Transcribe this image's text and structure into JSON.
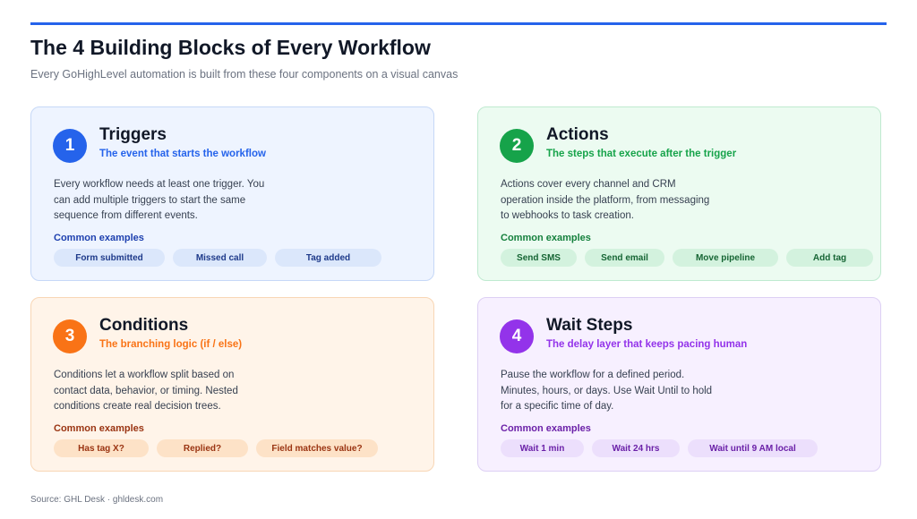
{
  "header": {
    "title": "The 4 Building Blocks of Every Workflow",
    "subtitle": "Every GoHighLevel automation is built from these four components on a visual canvas"
  },
  "colors": {
    "accent": "#2563eb",
    "triggers": "#2563eb",
    "actions": "#16a34a",
    "conditions": "#f97316",
    "wait_steps": "#9333ea"
  },
  "cards": [
    {
      "number": "1",
      "title": "Triggers",
      "subtitle": "The event that starts the workflow",
      "description": "Every workflow needs at least one trigger. You can add multiple triggers to start the same sequence from different events.",
      "examples_label": "Common examples",
      "examples": [
        "Form submitted",
        "Missed call",
        "Tag added"
      ]
    },
    {
      "number": "2",
      "title": "Actions",
      "subtitle": "The steps that execute after the trigger",
      "description": "Actions cover every channel and CRM operation inside the platform, from messaging to webhooks to task creation.",
      "examples_label": "Common examples",
      "examples": [
        "Send SMS",
        "Send email",
        "Move pipeline",
        "Add tag"
      ]
    },
    {
      "number": "3",
      "title": "Conditions",
      "subtitle": "The branching logic (if / else)",
      "description": "Conditions let a workflow split based on contact data, behavior, or timing. Nested conditions create real decision trees.",
      "examples_label": "Common examples",
      "examples": [
        "Has tag X?",
        "Replied?",
        "Field matches value?"
      ]
    },
    {
      "number": "4",
      "title": "Wait Steps",
      "subtitle": "The delay layer that keeps pacing human",
      "description": "Pause the workflow for a defined period. Minutes, hours, or days. Use Wait Until to hold for a specific time of day.",
      "examples_label": "Common examples",
      "examples": [
        "Wait 1 min",
        "Wait 24 hrs",
        "Wait until 9 AM local"
      ]
    }
  ],
  "footer": {
    "source": "Source: GHL Desk · ghldesk.com"
  }
}
